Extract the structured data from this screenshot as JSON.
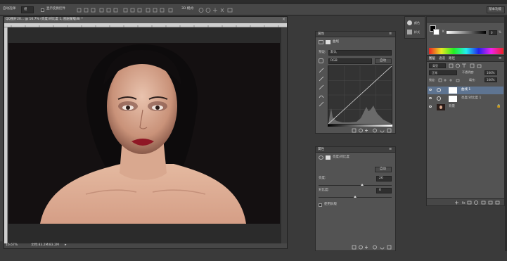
{
  "optionsbar": {
    "auto_select_label": "自动选择:",
    "auto_select_value": "组",
    "transform_label": "显示变换控件",
    "mode_3d_label": "3D 模式:",
    "workspace_label": "基本功能"
  },
  "document": {
    "tab_title": "QQ图片20... @ 16.7% (亮度/对比度 1, 图层蒙版/8) *",
    "zoom": "16.67%",
    "doc_info": "文档:83.2M/83.2M"
  },
  "properties_curves": {
    "header": "属性",
    "type_label": "曲线",
    "preset_label": "预设:",
    "preset_value": "默认",
    "channel_value": "RGB",
    "auto_button": "自动"
  },
  "properties_bc": {
    "header": "属性",
    "type_label": "亮度/对比度",
    "auto_button": "自动",
    "brightness_label": "亮度:",
    "brightness_value": "26",
    "contrast_label": "对比度:",
    "contrast_value": "0",
    "legacy_label": "使用旧版",
    "brightness_level": 0.6,
    "contrast_level": 0.5
  },
  "mini_panels": {
    "color_label": "颜色",
    "swatch_label": "样式"
  },
  "color_panel": {
    "k_label": "K",
    "k_value": "0",
    "k_unit": "%"
  },
  "layers": {
    "tab_layers": "图层",
    "tab_channels": "通道",
    "tab_paths": "路径",
    "kind_label": "类型",
    "blend_mode": "正常",
    "opacity_label": "不透明度:",
    "opacity_value": "100%",
    "lock_label": "锁定:",
    "fill_label": "填充:",
    "fill_value": "100%",
    "items": [
      {
        "name": "曲线 1",
        "selected": true
      },
      {
        "name": "亮度/对比度 1",
        "selected": false
      },
      {
        "name": "背景",
        "selected": false
      }
    ]
  },
  "colors": {
    "app_bg": "#3a3a3a",
    "panel_bg": "#535353",
    "selection": "#5e7491",
    "photo_bg": "#141011",
    "lips": "#8f1725"
  }
}
